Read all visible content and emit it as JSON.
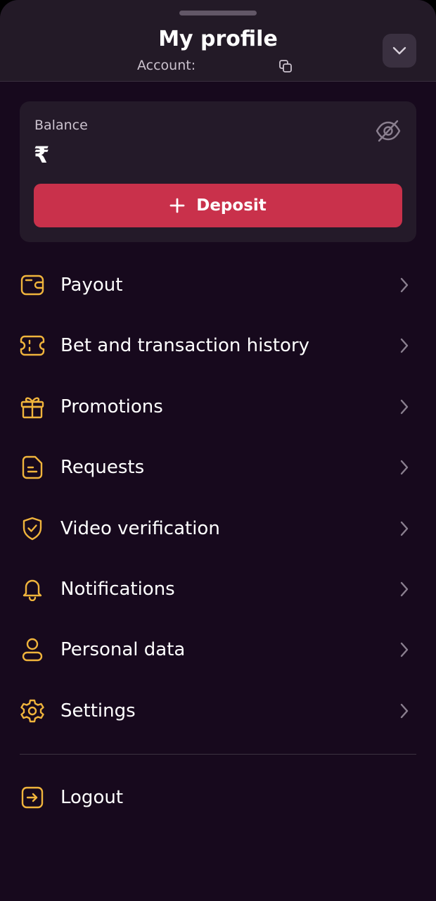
{
  "header": {
    "title": "My profile",
    "account_label": "Account:"
  },
  "balance": {
    "label": "Balance",
    "currency_symbol": "₹",
    "deposit_label": "Deposit"
  },
  "menu": {
    "items": [
      {
        "label": "Payout",
        "icon": "wallet-icon"
      },
      {
        "label": "Bet and transaction history",
        "icon": "ticket-icon"
      },
      {
        "label": "Promotions",
        "icon": "gift-icon"
      },
      {
        "label": "Requests",
        "icon": "document-icon"
      },
      {
        "label": "Video verification",
        "icon": "shield-check-icon"
      },
      {
        "label": "Notifications",
        "icon": "bell-icon"
      },
      {
        "label": "Personal data",
        "icon": "user-icon"
      },
      {
        "label": "Settings",
        "icon": "gear-icon"
      }
    ]
  },
  "logout": {
    "label": "Logout",
    "icon": "logout-icon"
  },
  "colors": {
    "background": "#17091d",
    "header_background": "#231a27",
    "card_background": "#241a29",
    "accent_icon": "#f0b43c",
    "deposit_button": "#c9314b",
    "text_primary": "#ffffff",
    "text_secondary": "#cbc2ce",
    "chevron": "#8a7f8f"
  }
}
